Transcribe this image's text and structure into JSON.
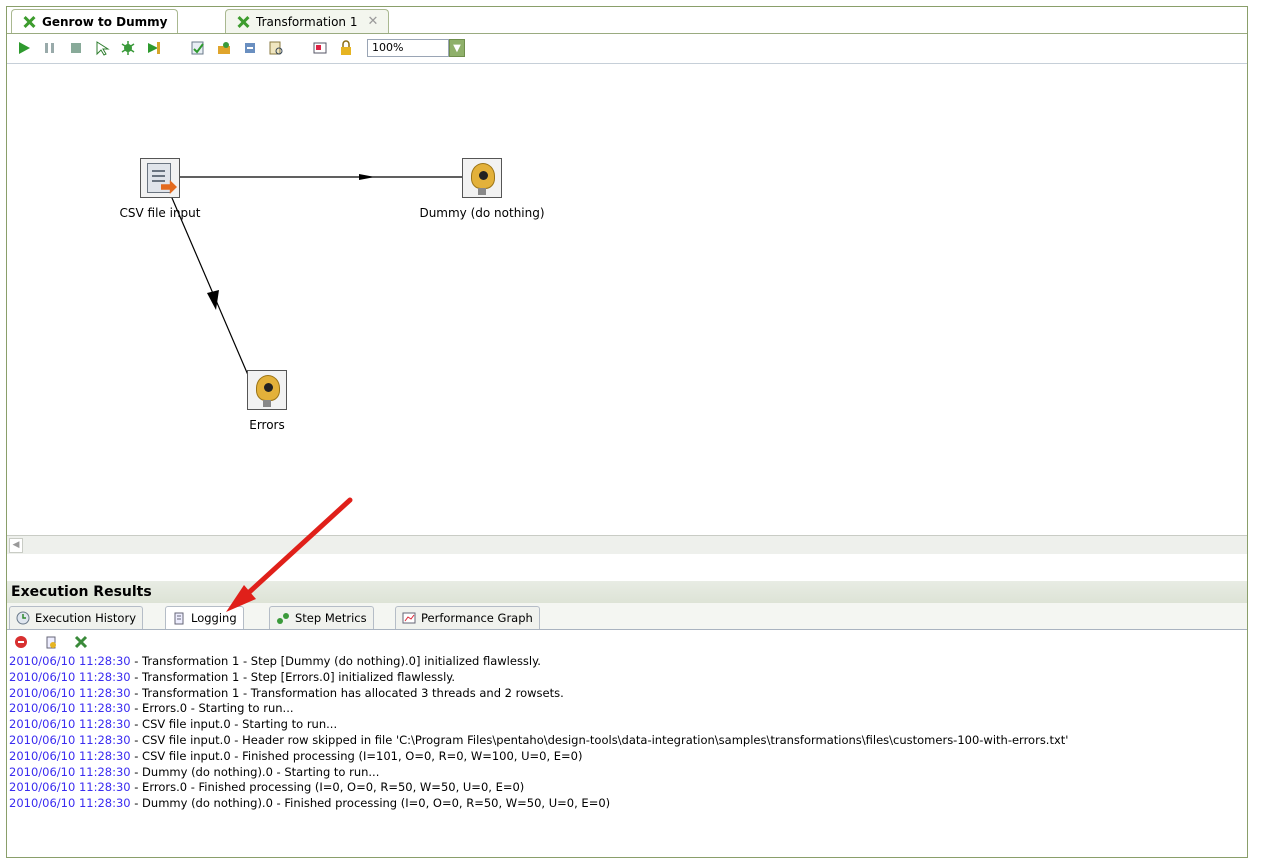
{
  "tabs": [
    {
      "label": "Genrow to Dummy",
      "active": true
    },
    {
      "label": "Transformation 1",
      "active": false
    }
  ],
  "toolbar": {
    "buttons": [
      "run-icon",
      "pause-icon",
      "stop-icon",
      "preview-icon",
      "debug-icon",
      "replay-icon",
      "verify-icon",
      "impact-icon",
      "sql-icon",
      "explore-db-icon",
      "show-results-icon",
      "lock-icon"
    ],
    "zoom": "100%"
  },
  "steps": {
    "csv": {
      "label": "CSV file input"
    },
    "dummy": {
      "label": "Dummy (do nothing)"
    },
    "errors": {
      "label": "Errors"
    }
  },
  "results": {
    "title": "Execution Results",
    "tabs": [
      {
        "label": "Execution History",
        "icon": "history-icon"
      },
      {
        "label": "Logging",
        "icon": "logging-icon"
      },
      {
        "label": "Step Metrics",
        "icon": "step-metrics-icon"
      },
      {
        "label": "Performance Graph",
        "icon": "performance-graph-icon"
      }
    ],
    "log": [
      {
        "ts": "2010/06/10 11:28:30",
        "msg": " - Transformation 1 - Step [Dummy (do nothing).0] initialized flawlessly."
      },
      {
        "ts": "2010/06/10 11:28:30",
        "msg": " - Transformation 1 - Step [Errors.0] initialized flawlessly."
      },
      {
        "ts": "2010/06/10 11:28:30",
        "msg": " - Transformation 1 - Transformation has allocated 3 threads and 2 rowsets."
      },
      {
        "ts": "2010/06/10 11:28:30",
        "msg": " - Errors.0 - Starting to run..."
      },
      {
        "ts": "2010/06/10 11:28:30",
        "msg": " - CSV file input.0 - Starting to run..."
      },
      {
        "ts": "2010/06/10 11:28:30",
        "msg": " - CSV file input.0 - Header row skipped in file 'C:\\Program Files\\pentaho\\design-tools\\data-integration\\samples\\transformations\\files\\customers-100-with-errors.txt'"
      },
      {
        "ts": "2010/06/10 11:28:30",
        "msg": " - CSV file input.0 - Finished processing (I=101, O=0, R=0, W=100, U=0, E=0)"
      },
      {
        "ts": "2010/06/10 11:28:30",
        "msg": " - Dummy (do nothing).0 - Starting to run..."
      },
      {
        "ts": "2010/06/10 11:28:30",
        "msg": " - Errors.0 - Finished processing (I=0, O=0, R=50, W=50, U=0, E=0)"
      },
      {
        "ts": "2010/06/10 11:28:30",
        "msg": " - Dummy (do nothing).0 - Finished processing (I=0, O=0, R=50, W=50, U=0, E=0)"
      }
    ]
  },
  "colors": {
    "timestamp": "#3a2cf0",
    "annotation_arrow": "#e0201a"
  }
}
